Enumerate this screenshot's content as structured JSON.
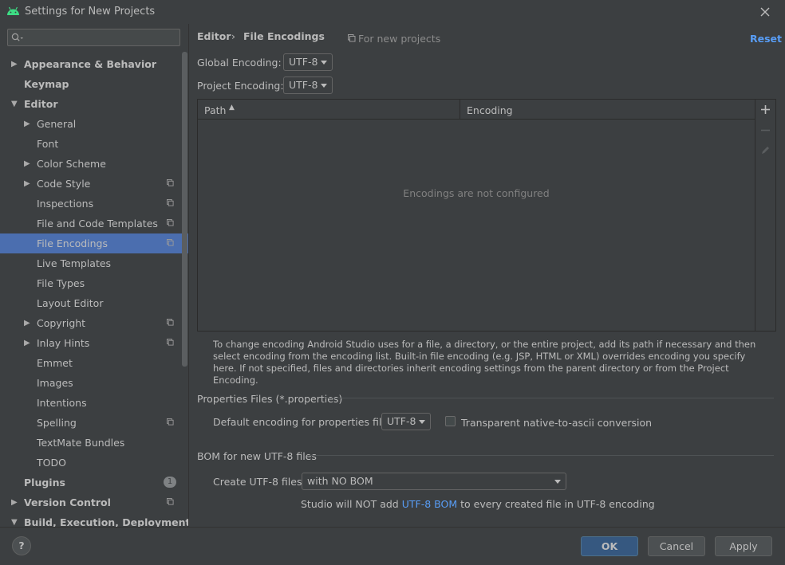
{
  "window": {
    "title": "Settings for New Projects",
    "icon": "android-icon"
  },
  "search": {
    "placeholder": "",
    "icon": "search-icon"
  },
  "sidebar": {
    "items": [
      {
        "label": "Appearance & Behavior",
        "level": 0,
        "bold": true,
        "arrow": "collapsed"
      },
      {
        "label": "Keymap",
        "level": 0,
        "bold": true,
        "arrow": "none"
      },
      {
        "label": "Editor",
        "level": 0,
        "bold": true,
        "arrow": "expanded"
      },
      {
        "label": "General",
        "level": 1,
        "arrow": "collapsed"
      },
      {
        "label": "Font",
        "level": 1,
        "arrow": "none"
      },
      {
        "label": "Color Scheme",
        "level": 1,
        "arrow": "collapsed"
      },
      {
        "label": "Code Style",
        "level": 1,
        "arrow": "collapsed",
        "project": true
      },
      {
        "label": "Inspections",
        "level": 1,
        "arrow": "none",
        "project": true
      },
      {
        "label": "File and Code Templates",
        "level": 1,
        "arrow": "none",
        "project": true
      },
      {
        "label": "File Encodings",
        "level": 1,
        "arrow": "none",
        "project": true,
        "selected": true
      },
      {
        "label": "Live Templates",
        "level": 1,
        "arrow": "none"
      },
      {
        "label": "File Types",
        "level": 1,
        "arrow": "none"
      },
      {
        "label": "Layout Editor",
        "level": 1,
        "arrow": "none"
      },
      {
        "label": "Copyright",
        "level": 1,
        "arrow": "collapsed",
        "project": true
      },
      {
        "label": "Inlay Hints",
        "level": 1,
        "arrow": "collapsed",
        "project": true
      },
      {
        "label": "Emmet",
        "level": 1,
        "arrow": "none"
      },
      {
        "label": "Images",
        "level": 1,
        "arrow": "none"
      },
      {
        "label": "Intentions",
        "level": 1,
        "arrow": "none"
      },
      {
        "label": "Spelling",
        "level": 1,
        "arrow": "none",
        "project": true
      },
      {
        "label": "TextMate Bundles",
        "level": 1,
        "arrow": "none"
      },
      {
        "label": "TODO",
        "level": 1,
        "arrow": "none"
      },
      {
        "label": "Plugins",
        "level": 0,
        "bold": true,
        "arrow": "none",
        "badge": "1"
      },
      {
        "label": "Version Control",
        "level": 0,
        "bold": true,
        "arrow": "collapsed",
        "project": true
      },
      {
        "label": "Build, Execution, Deployment",
        "level": 0,
        "bold": true,
        "arrow": "expanded"
      }
    ]
  },
  "header": {
    "crumb_parent": "Editor",
    "crumb_separator": "›",
    "crumb_current": "File Encodings",
    "scope_note": "For new projects",
    "reset_label": "Reset"
  },
  "encodings": {
    "global_label": "Global Encoding:",
    "global_value": "UTF-8",
    "project_label": "Project Encoding:",
    "project_value": "UTF-8"
  },
  "table": {
    "columns": [
      "Path",
      "Encoding"
    ],
    "sort_indicator": "▲",
    "empty_text": "Encodings are not configured"
  },
  "help_text": "To change encoding Android Studio uses for a file, a directory, or the entire project, add its path if necessary and then select encoding from the encoding list. Built-in file encoding (e.g. JSP, HTML or XML) overrides encoding you specify here. If not specified, files and directories inherit encoding settings from the parent directory or from the Project Encoding.",
  "properties": {
    "section_title": "Properties Files (*.properties)",
    "default_label": "Default encoding for properties files:",
    "default_value": "UTF-8",
    "transparent_label": "Transparent native-to-ascii conversion",
    "transparent_checked": false
  },
  "bom": {
    "section_title": "BOM for new UTF-8 files",
    "create_label": "Create UTF-8 files:",
    "create_value": "with NO BOM",
    "note_prefix": "Studio will NOT add",
    "note_link": "UTF-8 BOM",
    "note_suffix": "to every created file in UTF-8 encoding"
  },
  "buttons": {
    "ok": "OK",
    "cancel": "Cancel",
    "apply": "Apply",
    "help": "?"
  },
  "colors": {
    "accent": "#589df6",
    "selection": "#4b6eaf",
    "android_green": "#3ddc84",
    "primary_button": "#365880"
  }
}
